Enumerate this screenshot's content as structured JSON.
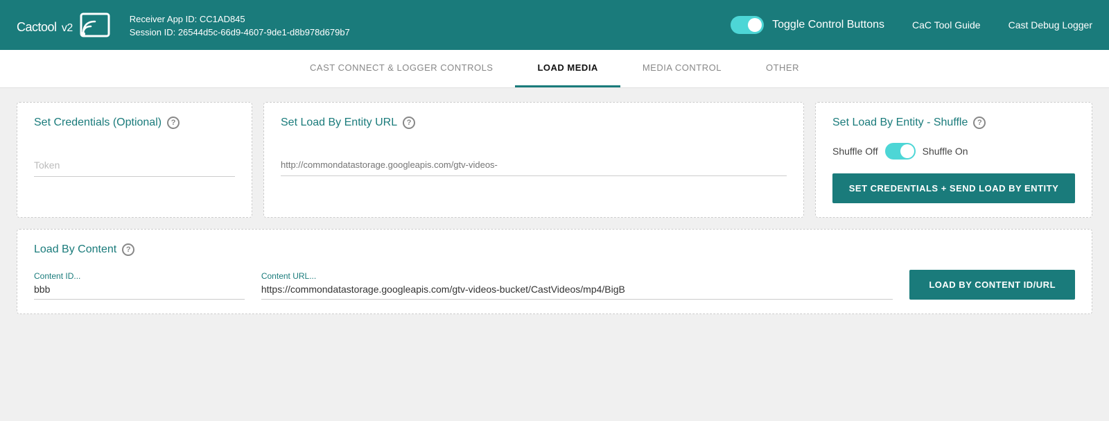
{
  "header": {
    "logo_text": "Cactool",
    "logo_version": "v2",
    "app_id_label": "Receiver App ID:",
    "app_id_value": "CC1AD845",
    "session_id_label": "Session ID:",
    "session_id_value": "26544d5c-66d9-4607-9de1-d8b978d679b7",
    "toggle_label": "Toggle Control Buttons",
    "nav_guide": "CaC Tool Guide",
    "nav_logger": "Cast Debug Logger"
  },
  "tabs": [
    {
      "id": "cast-connect",
      "label": "CAST CONNECT & LOGGER CONTROLS",
      "active": false
    },
    {
      "id": "load-media",
      "label": "LOAD MEDIA",
      "active": true
    },
    {
      "id": "media-control",
      "label": "MEDIA CONTROL",
      "active": false
    },
    {
      "id": "other",
      "label": "OTHER",
      "active": false
    }
  ],
  "sections": {
    "credentials": {
      "title": "Set Credentials (Optional)",
      "token_placeholder": "Token"
    },
    "load_by_entity_url": {
      "title": "Set Load By Entity URL",
      "url_placeholder": "http://commondatastorage.googleapis.com/gtv-videos-"
    },
    "load_by_entity_shuffle": {
      "title": "Set Load By Entity - Shuffle",
      "shuffle_off_label": "Shuffle Off",
      "shuffle_on_label": "Shuffle On",
      "button_label": "SET CREDENTIALS + SEND LOAD BY ENTITY"
    },
    "load_by_content": {
      "title": "Load By Content",
      "content_id_label": "Content ID...",
      "content_id_value": "bbb",
      "content_url_label": "Content URL...",
      "content_url_value": "https://commondatastorage.googleapis.com/gtv-videos-bucket/CastVideos/mp4/BigB",
      "button_label": "LOAD BY CONTENT ID/URL"
    }
  },
  "colors": {
    "teal": "#1a7b7b",
    "toggle_bg": "#4dd6d6"
  }
}
